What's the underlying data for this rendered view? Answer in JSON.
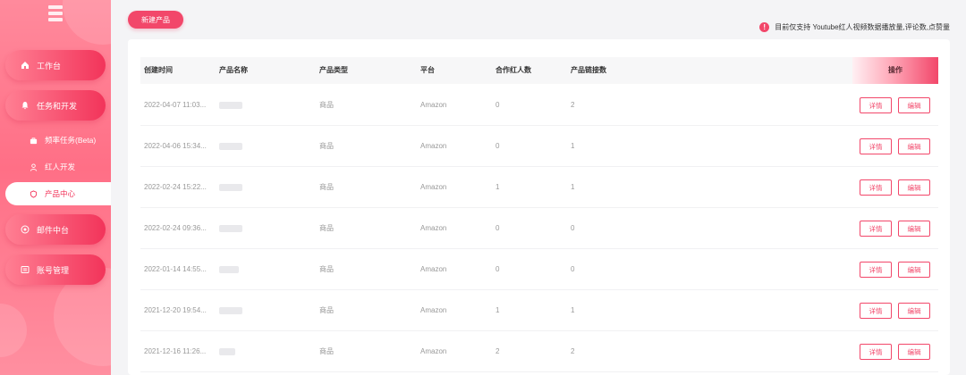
{
  "sidebar": {
    "menu": [
      {
        "label": "工作台",
        "icon": "home-icon"
      },
      {
        "label": "任务和开发",
        "icon": "bell-icon"
      },
      {
        "label": "邮件中台",
        "icon": "mail-icon"
      },
      {
        "label": "账号管理",
        "icon": "account-icon"
      }
    ],
    "sub": [
      {
        "label": "频率任务(Beta)",
        "icon": "bag-icon"
      },
      {
        "label": "红人开发",
        "icon": "person-icon"
      },
      {
        "label": "产品中心",
        "icon": "shield-icon"
      }
    ]
  },
  "toolbar": {
    "new_product": "新建产品"
  },
  "notice": {
    "text": "目前仅支持 Youtube红人视频数据播放量,评论数,点赞量"
  },
  "table": {
    "columns": [
      "创建时间",
      "产品名称",
      "产品类型",
      "平台",
      "合作红人数",
      "产品链接数",
      "操作"
    ],
    "actions": {
      "detail": "详情",
      "edit": "编辑"
    },
    "rows": [
      {
        "time": "2022-04-07 11:03...",
        "type": "商品",
        "platform": "Amazon",
        "influencers": "0",
        "links": "2"
      },
      {
        "time": "2022-04-06 15:34...",
        "type": "商品",
        "platform": "Amazon",
        "influencers": "0",
        "links": "1"
      },
      {
        "time": "2022-02-24 15:22...",
        "type": "商品",
        "platform": "Amazon",
        "influencers": "1",
        "links": "1"
      },
      {
        "time": "2022-02-24 09:36...",
        "type": "商品",
        "platform": "Amazon",
        "influencers": "0",
        "links": "0"
      },
      {
        "time": "2022-01-14 14:55...",
        "type": "商品",
        "platform": "Amazon",
        "influencers": "0",
        "links": "0"
      },
      {
        "time": "2021-12-20 19:54...",
        "type": "商品",
        "platform": "Amazon",
        "influencers": "1",
        "links": "1"
      },
      {
        "time": "2021-12-16 11:26...",
        "type": "商品",
        "platform": "Amazon",
        "influencers": "2",
        "links": "2"
      }
    ]
  },
  "colors": {
    "accent": "#f2476a",
    "sidebar": "#ff7a8f"
  }
}
